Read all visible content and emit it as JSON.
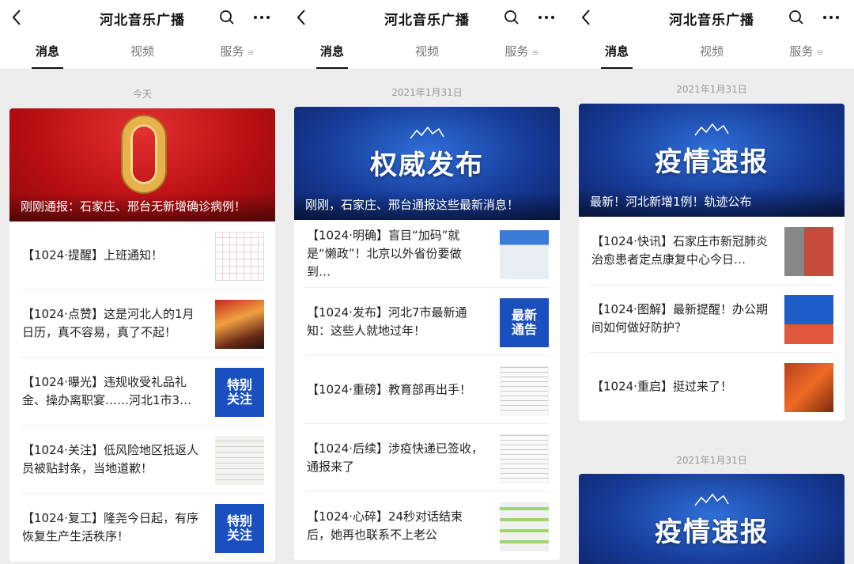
{
  "app": {
    "title": "河北音乐广播"
  },
  "tabs": [
    {
      "label": "消息"
    },
    {
      "label": "视频"
    },
    {
      "label": "服务"
    }
  ],
  "panel1": {
    "date": "今天",
    "banner_caption": "刚刚通报：石家庄、邢台无新增确诊病例！",
    "items": [
      {
        "text": "【1024·提醒】上班通知！"
      },
      {
        "text": "【1024·点赞】这是河北人的1月日历，真不容易，真了不起！"
      },
      {
        "text": "【1024·曝光】违规收受礼品礼金、操办离职宴……河北1市3…",
        "thumb_text": "特别\n关注"
      },
      {
        "text": "【1024·关注】低风险地区抵返人员被贴封条，当地道歉！"
      },
      {
        "text": "【1024·复工】隆尧今日起，有序恢复生产生活秩序！",
        "thumb_text": "特别\n关注"
      }
    ]
  },
  "panel2": {
    "date": "2021年1月31日",
    "banner_title": "权威发布",
    "banner_caption": "刚刚，石家庄、邢台通报这些最新消息！",
    "items": [
      {
        "text": "【1024·明确】盲目“加码”就是“懒政”！北京以外省份要做到…"
      },
      {
        "text": "【1024·发布】河北7市最新通知：这些人就地过年！",
        "thumb_text": "最新\n通告"
      },
      {
        "text": "【1024·重磅】教育部再出手！"
      },
      {
        "text": "【1024·后续】涉疫快递已签收，通报来了"
      },
      {
        "text": "【1024·心碎】24秒对话结束后，她再也联系不上老公"
      }
    ]
  },
  "panel3": {
    "date": "2021年1月31日",
    "banner_title": "疫情速报",
    "banner_caption": "最新！河北新增1例！轨迹公布",
    "items": [
      {
        "text": "【1024·快讯】石家庄市新冠肺炎治愈患者定点康复中心今日…"
      },
      {
        "text": "【1024·图解】最新提醒！办公期间如何做好防护？"
      },
      {
        "text": "【1024·重启】挺过来了！"
      }
    ],
    "date2": "2021年1月31日",
    "banner2_title": "疫情速报"
  },
  "colors": {
    "red_banner": "#b70e12",
    "blue_banner": "#173c9a",
    "gold": "#e6b24a"
  }
}
